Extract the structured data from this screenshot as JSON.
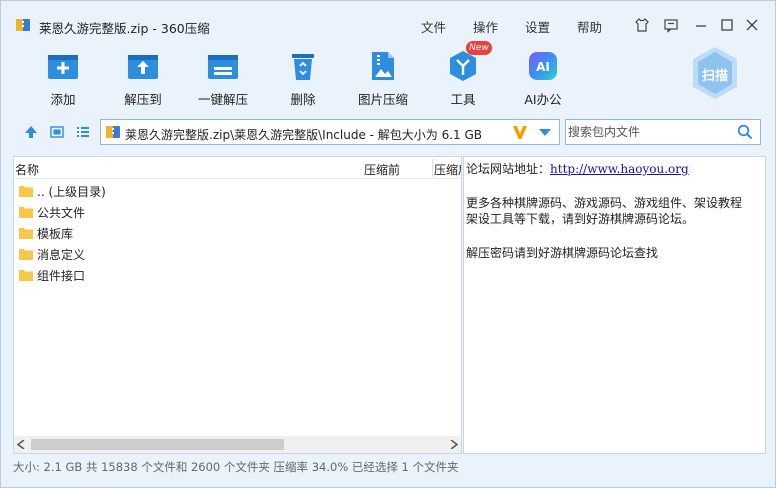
{
  "window": {
    "title": "莱恩久游完整版.zip - 360压缩"
  },
  "menu": {
    "file": "文件",
    "operation": "操作",
    "settings": "设置",
    "help": "帮助"
  },
  "toolbar": {
    "add": "添加",
    "extract_to": "解压到",
    "one_click_extract": "一键解压",
    "delete": "删除",
    "image_compress": "图片压缩",
    "tools": "工具",
    "tools_badge": "New",
    "ai_office": "AI办公",
    "ai_icon_text": "AI",
    "scan": "扫描"
  },
  "address": {
    "path": "莱恩久游完整版.zip\\莱恩久游完整版\\Include - 解包大小为 6.1 GB"
  },
  "search": {
    "placeholder": "搜索包内文件"
  },
  "file_list": {
    "columns": {
      "name": "名称",
      "compressed_before": "压缩前",
      "compressed_after": "压缩后"
    },
    "rows": [
      ".. (上级目录)",
      "公共文件",
      "模板库",
      "消息定义",
      "组件接口"
    ]
  },
  "preview": {
    "line1_label": "论坛网站地址：",
    "line1_link": "http://www.haoyou.org",
    "line2": "更多各种棋牌源码、游戏源码、游戏组件、架设教程",
    "line3": "架设工具等下载，请到好游棋牌源码论坛。",
    "line4": "解压密码请到好游棋牌源码论坛查找"
  },
  "status": {
    "text": "大小: 2.1 GB 共 15838 个文件和 2600 个文件夹 压缩率 34.0% 已经选择 1 个文件夹"
  },
  "colors": {
    "accent_blue": "#2d8ee0",
    "window_bg": "#eaf3fc",
    "badge_red": "#e8413c",
    "v_orange": "#f0a000",
    "folder_yellow": "#f6c84a"
  }
}
